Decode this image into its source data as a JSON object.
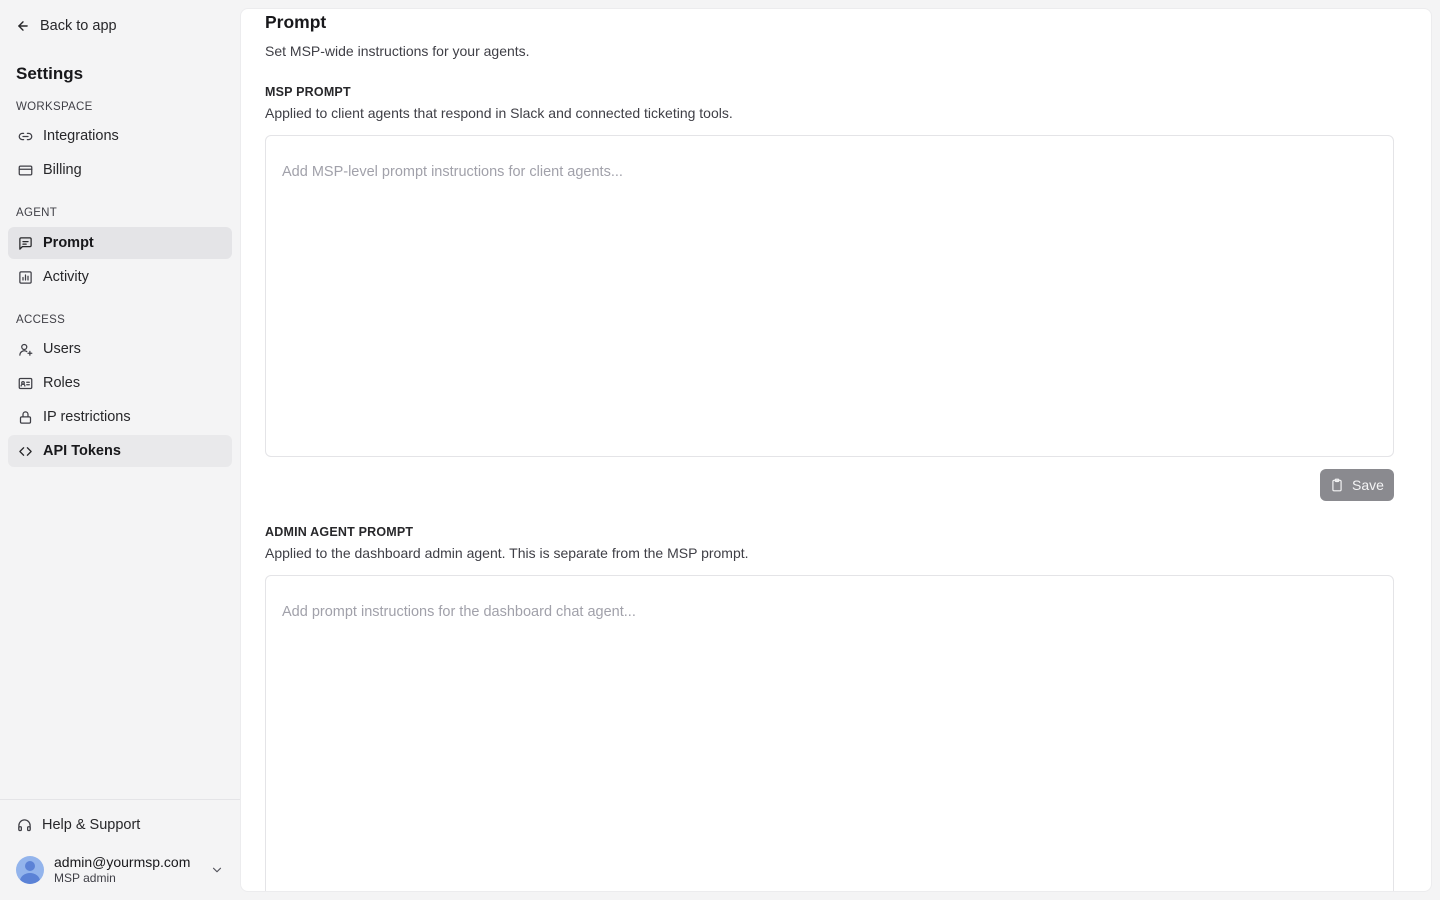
{
  "sidebar": {
    "back_label": "Back to app",
    "title": "Settings",
    "sections": {
      "workspace": "WORKSPACE",
      "agent": "AGENT",
      "access": "ACCESS"
    },
    "items": [
      {
        "label": "Integrations",
        "icon": "link-icon"
      },
      {
        "label": "Billing",
        "icon": "credit-card-icon"
      },
      {
        "label": "Prompt",
        "icon": "message-square-icon",
        "state": "active"
      },
      {
        "label": "Activity",
        "icon": "chart-icon"
      },
      {
        "label": "Users",
        "icon": "user-plus-icon"
      },
      {
        "label": "Roles",
        "icon": "id-card-icon"
      },
      {
        "label": "IP restrictions",
        "icon": "lock-icon"
      },
      {
        "label": "API Tokens",
        "icon": "code-icon",
        "state": "hover"
      }
    ],
    "footer": {
      "help_label": "Help & Support",
      "user_email": "admin@yourmsp.com",
      "user_role": "MSP admin"
    }
  },
  "main": {
    "title": "Prompt",
    "subtitle": "Set MSP-wide instructions for your agents.",
    "msp_prompt": {
      "label": "MSP PROMPT",
      "description": "Applied to client agents that respond in Slack and connected ticketing tools.",
      "value": "",
      "placeholder": "Add MSP-level prompt instructions for client agents...",
      "save_label": "Save"
    },
    "admin_prompt": {
      "label": "ADMIN AGENT PROMPT",
      "description": "Applied to the dashboard admin agent. This is separate from the MSP prompt.",
      "value": "",
      "placeholder": "Add prompt instructions for the dashboard chat agent..."
    }
  },
  "colors": {
    "sidebar_bg": "#f4f4f5",
    "active_item_bg": "#e4e4e7",
    "save_button_bg": "#8a8a8f",
    "avatar_bg": "#93b4ec"
  }
}
